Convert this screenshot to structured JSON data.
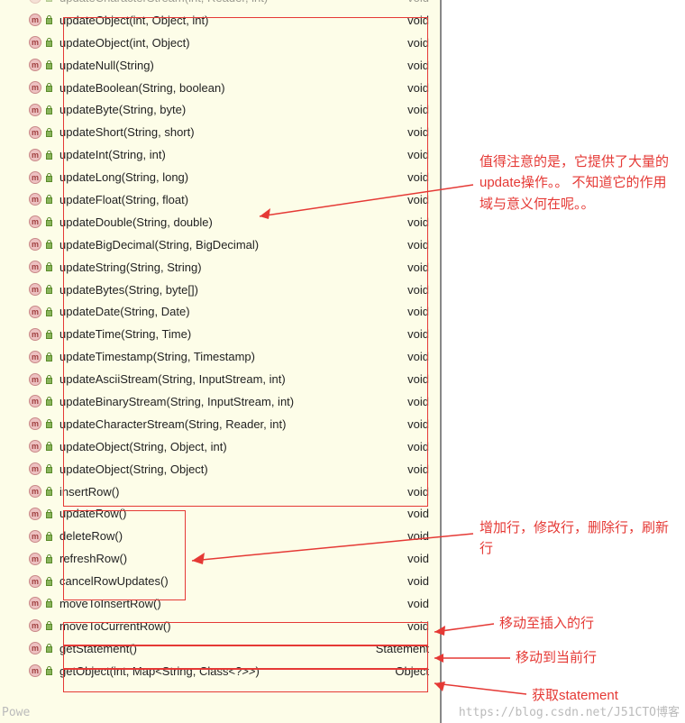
{
  "methods": [
    {
      "name": "updateCharacterStream(int, Reader, int)",
      "ret": "void"
    },
    {
      "name": "updateObject(int, Object, int)",
      "ret": "void"
    },
    {
      "name": "updateObject(int, Object)",
      "ret": "void"
    },
    {
      "name": "updateNull(String)",
      "ret": "void"
    },
    {
      "name": "updateBoolean(String, boolean)",
      "ret": "void"
    },
    {
      "name": "updateByte(String, byte)",
      "ret": "void"
    },
    {
      "name": "updateShort(String, short)",
      "ret": "void"
    },
    {
      "name": "updateInt(String, int)",
      "ret": "void"
    },
    {
      "name": "updateLong(String, long)",
      "ret": "void"
    },
    {
      "name": "updateFloat(String, float)",
      "ret": "void"
    },
    {
      "name": "updateDouble(String, double)",
      "ret": "void"
    },
    {
      "name": "updateBigDecimal(String, BigDecimal)",
      "ret": "void"
    },
    {
      "name": "updateString(String, String)",
      "ret": "void"
    },
    {
      "name": "updateBytes(String, byte[])",
      "ret": "void"
    },
    {
      "name": "updateDate(String, Date)",
      "ret": "void"
    },
    {
      "name": "updateTime(String, Time)",
      "ret": "void"
    },
    {
      "name": "updateTimestamp(String, Timestamp)",
      "ret": "void"
    },
    {
      "name": "updateAsciiStream(String, InputStream, int)",
      "ret": "void"
    },
    {
      "name": "updateBinaryStream(String, InputStream, int)",
      "ret": "void"
    },
    {
      "name": "updateCharacterStream(String, Reader, int)",
      "ret": "void"
    },
    {
      "name": "updateObject(String, Object, int)",
      "ret": "void"
    },
    {
      "name": "updateObject(String, Object)",
      "ret": "void"
    },
    {
      "name": "insertRow()",
      "ret": "void"
    },
    {
      "name": "updateRow()",
      "ret": "void"
    },
    {
      "name": "deleteRow()",
      "ret": "void"
    },
    {
      "name": "refreshRow()",
      "ret": "void"
    },
    {
      "name": "cancelRowUpdates()",
      "ret": "void"
    },
    {
      "name": "moveToInsertRow()",
      "ret": "void"
    },
    {
      "name": "moveToCurrentRow()",
      "ret": "void"
    },
    {
      "name": "getStatement()",
      "ret": "Statement"
    },
    {
      "name": "getObject(int, Map<String, Class<?>>)",
      "ret": "Object"
    }
  ],
  "icon_letter": "m",
  "annotations": {
    "a1": "值得注意的是，它提供了大量的update操作。。 不知道它的作用域与意义何在呢。。",
    "a2": "增加行，修改行，删除行，刷新行",
    "a3": "移动至插入的行",
    "a4": "移动到当前行",
    "a5": "获取statement"
  },
  "watermark_left": "Powe",
  "watermark_right": "https://blog.csdn.net/J51CTO博客"
}
